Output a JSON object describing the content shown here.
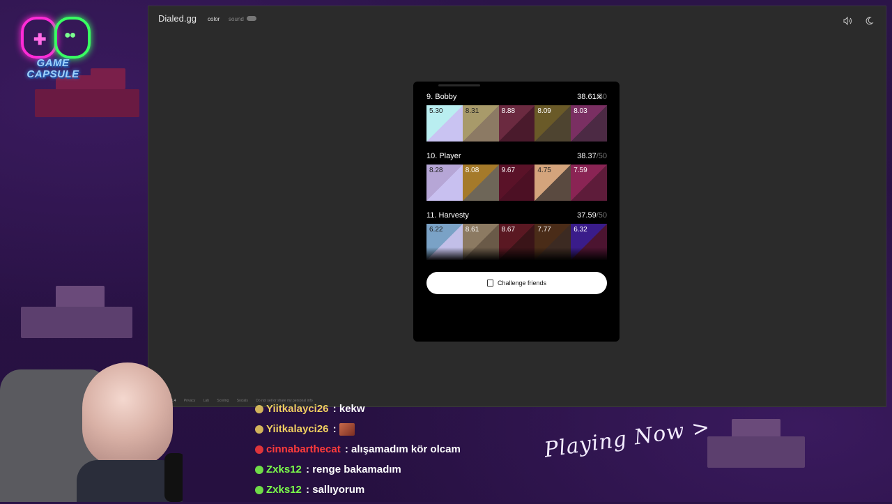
{
  "colors": {
    "overlay_bg": "#2a1347",
    "browser_bg": "#2b2b2b",
    "modal_bg": "#000000",
    "chat_user_red": "#ff3b3b",
    "chat_user_green": "#7cff4a",
    "chat_user_gold": "#f0d060"
  },
  "overlay": {
    "logo_line1": "GAME",
    "logo_line2": "CAPSULE",
    "playing_now": "Playing Now >"
  },
  "app": {
    "brand": "Dialed.gg",
    "nav_color": "color",
    "nav_sound": "sound",
    "sound_icon": "speaker-icon",
    "theme_icon": "moon-icon",
    "footer": {
      "version": "v1.4",
      "links": [
        "Privacy",
        "Lab",
        "Scoring",
        "Socials",
        "Do not sell or share my personal info"
      ]
    }
  },
  "leaderboard": {
    "entries": [
      {
        "rank_name": "9. Bobby",
        "score": "38.61",
        "total": "/50",
        "swatches": [
          {
            "value": "5.30",
            "c1": "#b9eef0",
            "c2": "#c9c3f2",
            "dark": true
          },
          {
            "value": "8.31",
            "c1": "#a89a6a",
            "c2": "#8c7a64",
            "dark": true
          },
          {
            "value": "8.88",
            "c1": "#6b2a40",
            "c2": "#4a1a2c",
            "dark": false
          },
          {
            "value": "8.09",
            "c1": "#6a5a28",
            "c2": "#4e4430",
            "dark": false
          },
          {
            "value": "8.03",
            "c1": "#7a2f62",
            "c2": "#4c2a44",
            "dark": false
          }
        ]
      },
      {
        "rank_name": "10. Player",
        "score": "38.37",
        "total": "/50",
        "swatches": [
          {
            "value": "8.28",
            "c1": "#b6a6d6",
            "c2": "#c8c0f0",
            "dark": true
          },
          {
            "value": "8.08",
            "c1": "#a57a2a",
            "c2": "#6e6658",
            "dark": false
          },
          {
            "value": "9.67",
            "c1": "#5a1228",
            "c2": "#4c1024",
            "dark": false
          },
          {
            "value": "4.75",
            "c1": "#d4a47c",
            "c2": "#5a4a40",
            "dark": true
          },
          {
            "value": "7.59",
            "c1": "#8a2454",
            "c2": "#5e1c3a",
            "dark": false
          }
        ]
      },
      {
        "rank_name": "11. Harvesty",
        "score": "37.59",
        "total": "/50",
        "swatches": [
          {
            "value": "6.22",
            "c1": "#7aa2c6",
            "c2": "#c2bfe8",
            "dark": true
          },
          {
            "value": "8.61",
            "c1": "#8c7a62",
            "c2": "#6a5a48",
            "dark": false
          },
          {
            "value": "8.67",
            "c1": "#5a1822",
            "c2": "#3a1418",
            "dark": false
          },
          {
            "value": "7.77",
            "c1": "#4a2c18",
            "c2": "#3c2a22",
            "dark": false
          },
          {
            "value": "6.32",
            "c1": "#3a1c8a",
            "c2": "#4c1430",
            "dark": false
          }
        ]
      }
    ],
    "challenge_label": "Challenge friends",
    "copy_icon": "copy-icon",
    "close_icon": "close-icon"
  },
  "chat": [
    {
      "user": "Yiitkalayci26",
      "sep": " : ",
      "msg": "kekw",
      "color": "#f0d060"
    },
    {
      "user": "Yiitkalayci26",
      "sep": " : ",
      "msg": "",
      "emote": true,
      "color": "#f0d060"
    },
    {
      "user": "cinnabarthecat",
      "sep": " : ",
      "msg": "alışamadım kör olcam",
      "color": "#ff3b3b"
    },
    {
      "user": "Zxks12",
      "sep": " : ",
      "msg": "renge bakamadım",
      "color": "#7cff4a"
    },
    {
      "user": "Zxks12",
      "sep": " : ",
      "msg": "sallıyorum",
      "color": "#7cff4a"
    }
  ]
}
